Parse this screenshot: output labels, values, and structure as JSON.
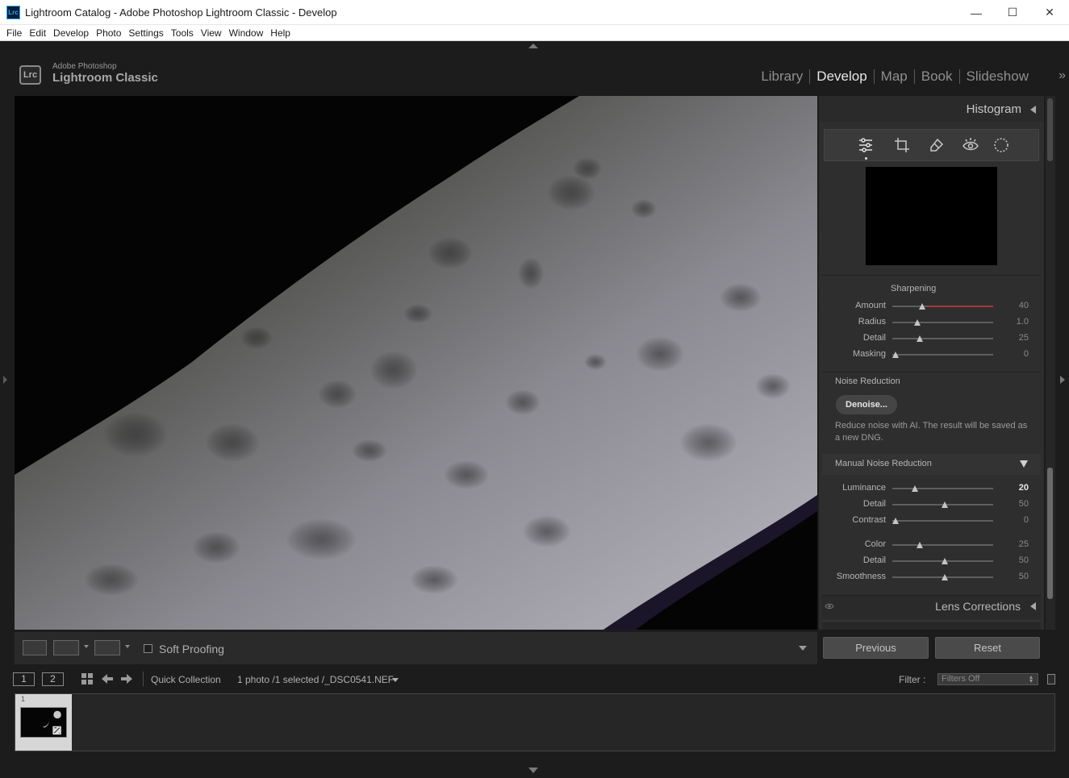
{
  "window": {
    "title": "Lightroom Catalog - Adobe Photoshop Lightroom Classic - Develop",
    "app_icon": "Lrc",
    "minimize": "—",
    "maximize": "☐",
    "close": "✕"
  },
  "menu": [
    "File",
    "Edit",
    "Develop",
    "Photo",
    "Settings",
    "Tools",
    "View",
    "Window",
    "Help"
  ],
  "identity": {
    "badge": "Lrc",
    "line1": "Adobe Photoshop",
    "line2": "Lightroom Classic"
  },
  "modules": [
    {
      "label": "Library",
      "active": false
    },
    {
      "label": "Develop",
      "active": true
    },
    {
      "label": "Map",
      "active": false
    },
    {
      "label": "Book",
      "active": false
    },
    {
      "label": "Slideshow",
      "active": false
    }
  ],
  "modules_expand": "»",
  "toolbar": {
    "soft_proofing_label": "Soft Proofing",
    "soft_proofing_checked": false,
    "view_icons": [
      "loupe-view-icon",
      "before-after-lr-icon",
      "before-after-tb-icon"
    ]
  },
  "right_panel": {
    "histogram_title": "Histogram",
    "tools": [
      "edit-sliders-icon",
      "crop-icon",
      "healing-icon",
      "red-eye-icon",
      "masking-icon"
    ],
    "sharpening": {
      "title": "Sharpening",
      "sliders": [
        {
          "label": "Amount",
          "value": "40",
          "fraction": 0.27
        },
        {
          "label": "Radius",
          "value": "1.0",
          "fraction": 0.22
        },
        {
          "label": "Detail",
          "value": "25",
          "fraction": 0.25
        },
        {
          "label": "Masking",
          "value": "0",
          "fraction": 0.0
        }
      ]
    },
    "noise_reduction": {
      "title": "Noise Reduction",
      "denoise_label": "Denoise...",
      "note": "Reduce noise with AI. The result will be saved as a new DNG.",
      "manual_title": "Manual Noise Reduction",
      "luminance_sliders": [
        {
          "label": "Luminance",
          "value": "20",
          "fraction": 0.2,
          "highlight": true
        },
        {
          "label": "Detail",
          "value": "50",
          "fraction": 0.5
        },
        {
          "label": "Contrast",
          "value": "0",
          "fraction": 0.0
        }
      ],
      "color_sliders": [
        {
          "label": "Color",
          "value": "25",
          "fraction": 0.25
        },
        {
          "label": "Detail",
          "value": "50",
          "fraction": 0.5
        },
        {
          "label": "Smoothness",
          "value": "50",
          "fraction": 0.5
        }
      ]
    },
    "lens_corrections_title": "Lens Corrections",
    "previous_label": "Previous",
    "reset_label": "Reset"
  },
  "filmstrip": {
    "view1": "1",
    "view2": "2",
    "source": "Quick Collection",
    "count": "1 photo /1 selected /_DSC0541.NEF",
    "filter_label": "Filter :",
    "filter_value": "Filters Off",
    "thumb_index": "1"
  },
  "colors": {
    "panel_bg": "#2e2e2e",
    "app_bg": "#1c1c1c",
    "accent_red": "#a33a3a"
  }
}
